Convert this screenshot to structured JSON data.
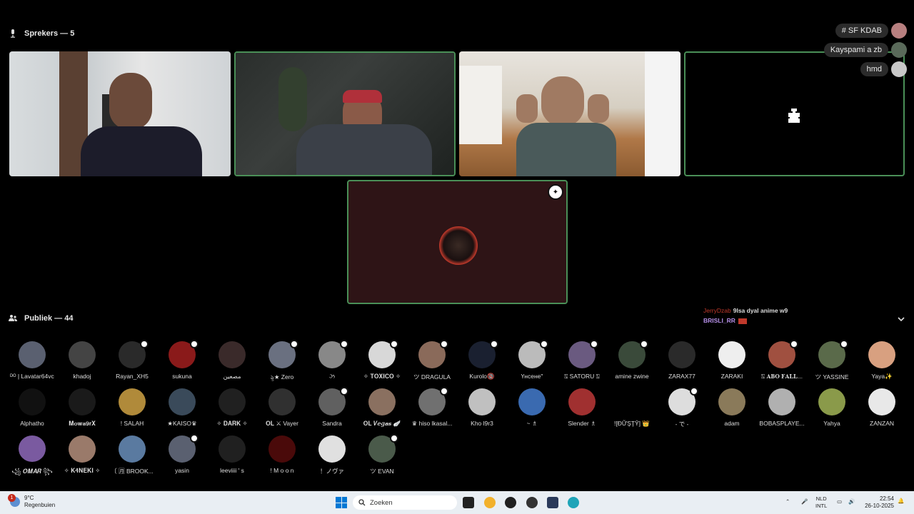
{
  "speakers_header": {
    "label": "Sprekers — 5"
  },
  "audience_header": {
    "label": "Publiek — 44"
  },
  "side_pills": [
    {
      "label": "# SF KDAB"
    },
    {
      "label": "Kayspami a zb"
    },
    {
      "label": "hmd"
    }
  ],
  "chat": {
    "user1": "JerryDzab",
    "msg1": "9lsa dyal anime w9",
    "user2": "BRISLI_RR"
  },
  "audience": [
    {
      "name": "ᴰᴼ | Lavatar64vc",
      "color": "#5a6070"
    },
    {
      "name": "khadoj",
      "color": "#444444"
    },
    {
      "name": "Rayan_XH5",
      "color": "#2a2a2a",
      "badge": true
    },
    {
      "name": "sukuna",
      "color": "#8a1a1a",
      "badge": true
    },
    {
      "name": "مصعين",
      "color": "#3a2a2a"
    },
    {
      "name": "ৡ★ Zero",
      "color": "#6a7080",
      "badge": true
    },
    {
      "name": "ઝ",
      "color": "#888888",
      "badge": true
    },
    {
      "name": "✧ 𝐓𝐎𝐗𝐈𝐂𝐎 ✧",
      "color": "#d8d8d8",
      "badge": true
    },
    {
      "name": "ツ DRAGULA",
      "color": "#8a6a5a",
      "badge": true
    },
    {
      "name": "Kurolo🔞",
      "color": "#1a2030",
      "badge": true
    },
    {
      "name": "Үнсене\"",
      "color": "#bbbbbb",
      "badge": true
    },
    {
      "name": "⍂ SATORU ⍂",
      "color": "#6a5a80",
      "badge": true
    },
    {
      "name": "amine zwine",
      "color": "#3a4a3a",
      "badge": true
    },
    {
      "name": "ZARAX77",
      "color": "#2a2a2a"
    },
    {
      "name": "ZARAKI",
      "color": "#eeeeee"
    },
    {
      "name": "⍂ 𝐀𝐁𝐎 𝐅𝐀𝐋𝐋...",
      "color": "#a05040",
      "badge": true
    },
    {
      "name": "ツ YASSINE",
      "color": "#5a6a4a",
      "badge": true
    },
    {
      "name": "Yaya✨",
      "color": "#d8a080"
    },
    {
      "name": "Alphatho",
      "color": "#111111"
    },
    {
      "name": "𝐌𝐨𝐰𝐚𝟗𝐫𝐗",
      "color": "#1a1a1a"
    },
    {
      "name": "! SALAH",
      "color": "#b08a3a"
    },
    {
      "name": "★KAISO♛",
      "color": "#3a4a5a"
    },
    {
      "name": "✧ 𝐃𝐀𝐑𝐊 ✧",
      "color": "#202020"
    },
    {
      "name": "𝐎𝐋 ⚔ Vayer",
      "color": "#303030"
    },
    {
      "name": "Sandra",
      "color": "#606060",
      "badge": true
    },
    {
      "name": "𝐎𝐋 𝑽𝒆𝒈𝒂𝒔 🪽",
      "color": "#8a7060"
    },
    {
      "name": "♛ hiso lkasal...",
      "color": "#707070",
      "badge": true
    },
    {
      "name": "Kho l9r3",
      "color": "#c0c0c0"
    },
    {
      "name": "~ ♗",
      "color": "#3a6ab0"
    },
    {
      "name": "Slender ♗",
      "color": "#a03030"
    },
    {
      "name": "![ĐỮŞŢŶ] 👑",
      "color": "#000000"
    },
    {
      "name": "- で -",
      "color": "#dddddd",
      "badge": true
    },
    {
      "name": "adam",
      "color": "#8a7a5a"
    },
    {
      "name": "BOBASPLAYE...",
      "color": "#b0b0b0"
    },
    {
      "name": "Yahya",
      "color": "#8a9a4a"
    },
    {
      "name": "ZANZAN",
      "color": "#e8e8e8"
    },
    {
      "name": "꧁ 𝑶𝑴𝑨𝑹 ꧂",
      "color": "#7a5aa0"
    },
    {
      "name": "✧ 𝐊𝟒𝐍𝐄𝐊𝐈 ✧",
      "color": "#9a7a6a"
    },
    {
      "name": "〔 🈷 BROOK...",
      "color": "#5a7aa0"
    },
    {
      "name": "yasin",
      "color": "#5a6070",
      "badge": true
    },
    {
      "name": "leeviiii ' s",
      "color": "#202020"
    },
    {
      "name": "! M o o n",
      "color": "#4a0a0a"
    },
    {
      "name": "！ノヴァ",
      "color": "#e0e0e0"
    },
    {
      "name": "ツ EVAN",
      "color": "#4a5a4a",
      "badge": true
    }
  ],
  "taskbar": {
    "weather_temp": "9°C",
    "weather_desc": "Regenbuien",
    "weather_notif": "1",
    "search_placeholder": "Zoeken",
    "lang1": "NLD",
    "lang2": "INTL",
    "time": "22:54",
    "date": "26-10-2025"
  }
}
